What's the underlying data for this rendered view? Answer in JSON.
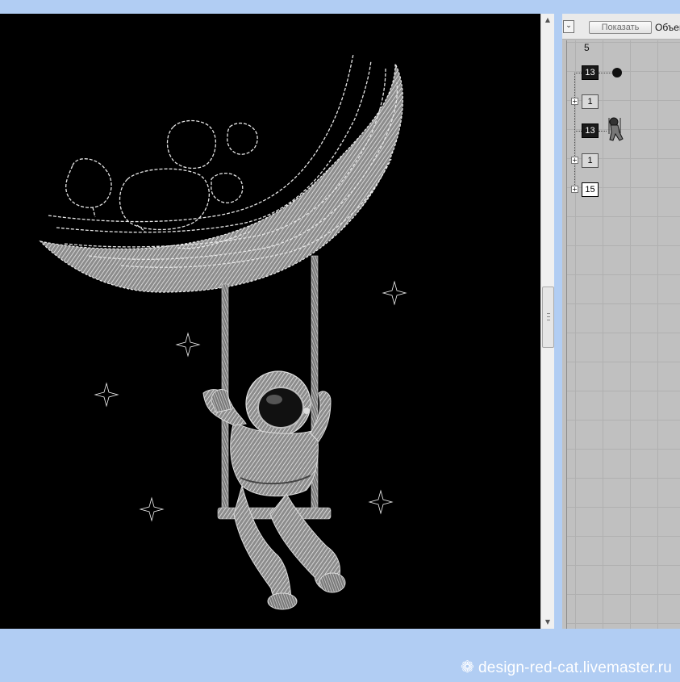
{
  "toolbar": {
    "collapse_icon": "chevron-double-down-icon",
    "show_button_label": "Показать",
    "objects_label": "Объек"
  },
  "layers": {
    "count_label": "5",
    "nodes": [
      {
        "label": "13",
        "style": "dark",
        "thumbnail": "black-dot"
      },
      {
        "label": "1",
        "style": "light",
        "expandable": true
      },
      {
        "label": "13",
        "style": "dark",
        "thumbnail": "astronaut"
      },
      {
        "label": "1",
        "style": "light",
        "expandable": true
      },
      {
        "label": "15",
        "style": "white",
        "expandable": true
      }
    ]
  },
  "canvas": {
    "background": "#000000",
    "stitch_color": "#d9d9d9",
    "motif": "astronaut on a swing hanging from a crescent moon, with stars"
  },
  "watermark": {
    "logo_icon": "snowflake-icon",
    "text": "design-red-cat.livemaster.ru"
  },
  "colors": {
    "frame": "#b1cdf3",
    "panel": "#c0c0c0",
    "node_dark": "#1a1a1a"
  }
}
